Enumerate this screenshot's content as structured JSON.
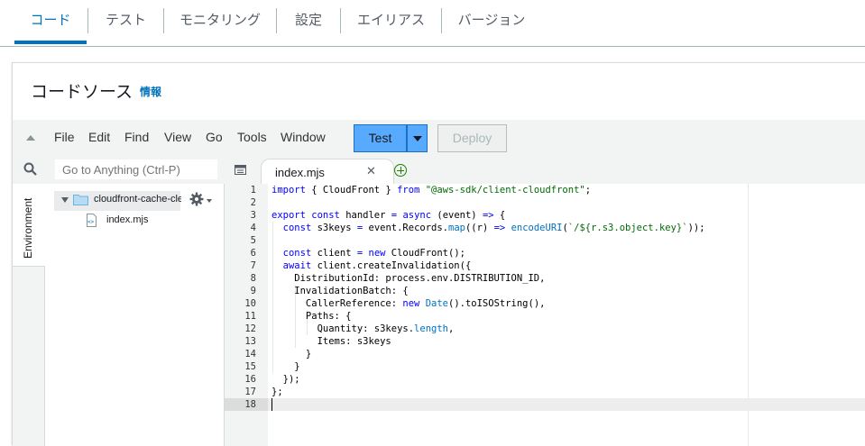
{
  "tabs": [
    {
      "label": "コード",
      "active": true
    },
    {
      "label": "テスト"
    },
    {
      "label": "モニタリング"
    },
    {
      "label": "設定"
    },
    {
      "label": "エイリアス"
    },
    {
      "label": "バージョン"
    }
  ],
  "panel": {
    "title": "コードソース",
    "info": "情報"
  },
  "menu": [
    "File",
    "Edit",
    "Find",
    "View",
    "Go",
    "Tools",
    "Window"
  ],
  "buttons": {
    "test": "Test",
    "deploy": "Deploy"
  },
  "search": {
    "placeholder": "Go to Anything (Ctrl-P)"
  },
  "sidebar": {
    "environment_label": "Environment",
    "folder": "cloudfront-cache-clear",
    "file": "index.mjs"
  },
  "editor": {
    "tab_label": "index.mjs",
    "lines": [
      "import { CloudFront } from \"@aws-sdk/client-cloudfront\";",
      "",
      "export const handler = async (event) => {",
      "  const s3keys = event.Records.map((r) => encodeURI(`/${r.s3.object.key}`));",
      "",
      "  const client = new CloudFront();",
      "  await client.createInvalidation({",
      "    DistributionId: process.env.DISTRIBUTION_ID,",
      "    InvalidationBatch: {",
      "      CallerReference: new Date().toISOString(),",
      "      Paths: {",
      "        Quantity: s3keys.length,",
      "        Items: s3keys",
      "      }",
      "    }",
      "  });",
      "};",
      ""
    ]
  },
  "colors": {
    "accent": "#0073bb",
    "test_button": "#58aaff",
    "keyword": "#0000ff",
    "string": "#036a07"
  }
}
